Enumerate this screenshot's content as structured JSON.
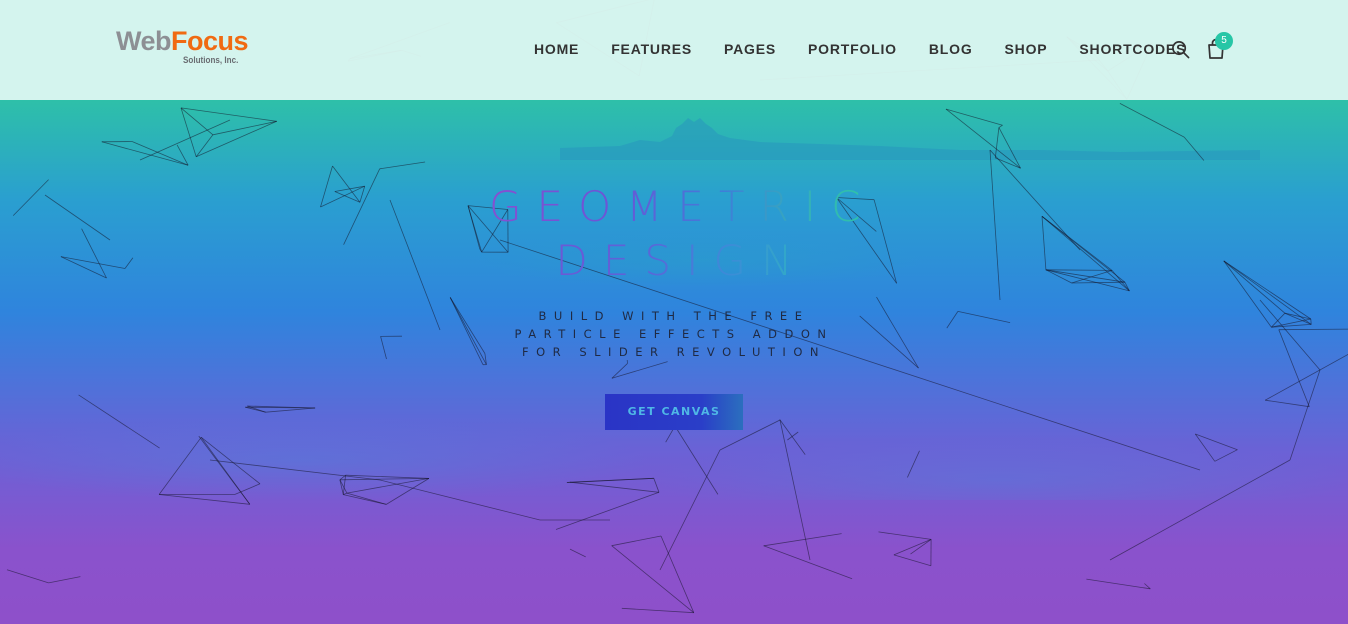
{
  "brand": {
    "name_part1": "Web",
    "name_part2": "Focus",
    "tagline": "Solutions, Inc.",
    "colors": {
      "gray": "#8d8f94",
      "orange": "#f06a12"
    }
  },
  "nav": {
    "items": [
      "HOME",
      "FEATURES",
      "PAGES",
      "PORTFOLIO",
      "BLOG",
      "SHOP",
      "SHORTCODES"
    ]
  },
  "header_icons": {
    "search": "search-icon",
    "cart": "shopping-bag-icon",
    "cart_count": "5"
  },
  "hero": {
    "headline_line1": "Geometric",
    "headline_line2": "Design",
    "subtext_line1": "BUILD WITH THE FREE",
    "subtext_line2": "PARTICLE EFFECTS ADDON",
    "subtext_line3": "FOR SLIDER REVOLUTION",
    "cta_label": "GET CANVAS",
    "gradient_colors": [
      "#2ec7a3",
      "#2a9fd0",
      "#2f84dd",
      "#6a62d6",
      "#8e50ca"
    ],
    "accent": "#27c6a6"
  }
}
